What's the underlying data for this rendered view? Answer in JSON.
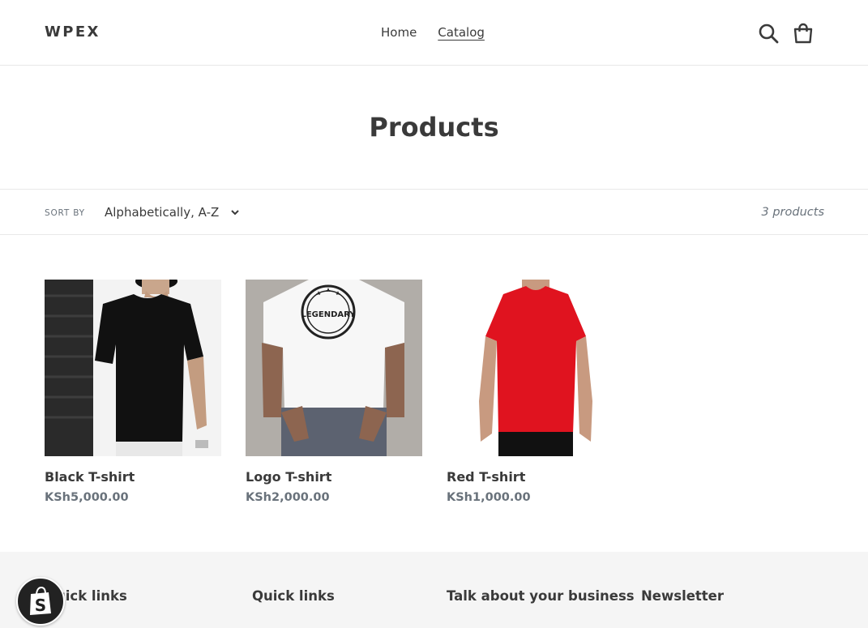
{
  "header": {
    "logo": "WPEX",
    "nav": [
      {
        "label": "Home",
        "active": false
      },
      {
        "label": "Catalog",
        "active": true
      }
    ],
    "icons": [
      "search-icon",
      "cart-icon"
    ]
  },
  "page": {
    "title": "Products"
  },
  "filters": {
    "sort_label": "SORT BY",
    "sort_value": "Alphabetically, A-Z",
    "count": "3 products"
  },
  "products": [
    {
      "name": "Black T-shirt",
      "price": "KSh5,000.00",
      "shirt_color": "#111111"
    },
    {
      "name": "Logo T-shirt",
      "price": "KSh2,000.00",
      "shirt_color": "#f7f7f7",
      "print": "LEGENDARY"
    },
    {
      "name": "Red T-shirt",
      "price": "KSh1,000.00",
      "shirt_color": "#e0131f"
    }
  ],
  "footer": {
    "headings": [
      "Quick links",
      "Quick links",
      "Talk about your business",
      "Newsletter"
    ]
  },
  "colors": {
    "text": "#3a3a3a",
    "muted": "#69727b",
    "footer_bg": "#f5f5f5"
  }
}
